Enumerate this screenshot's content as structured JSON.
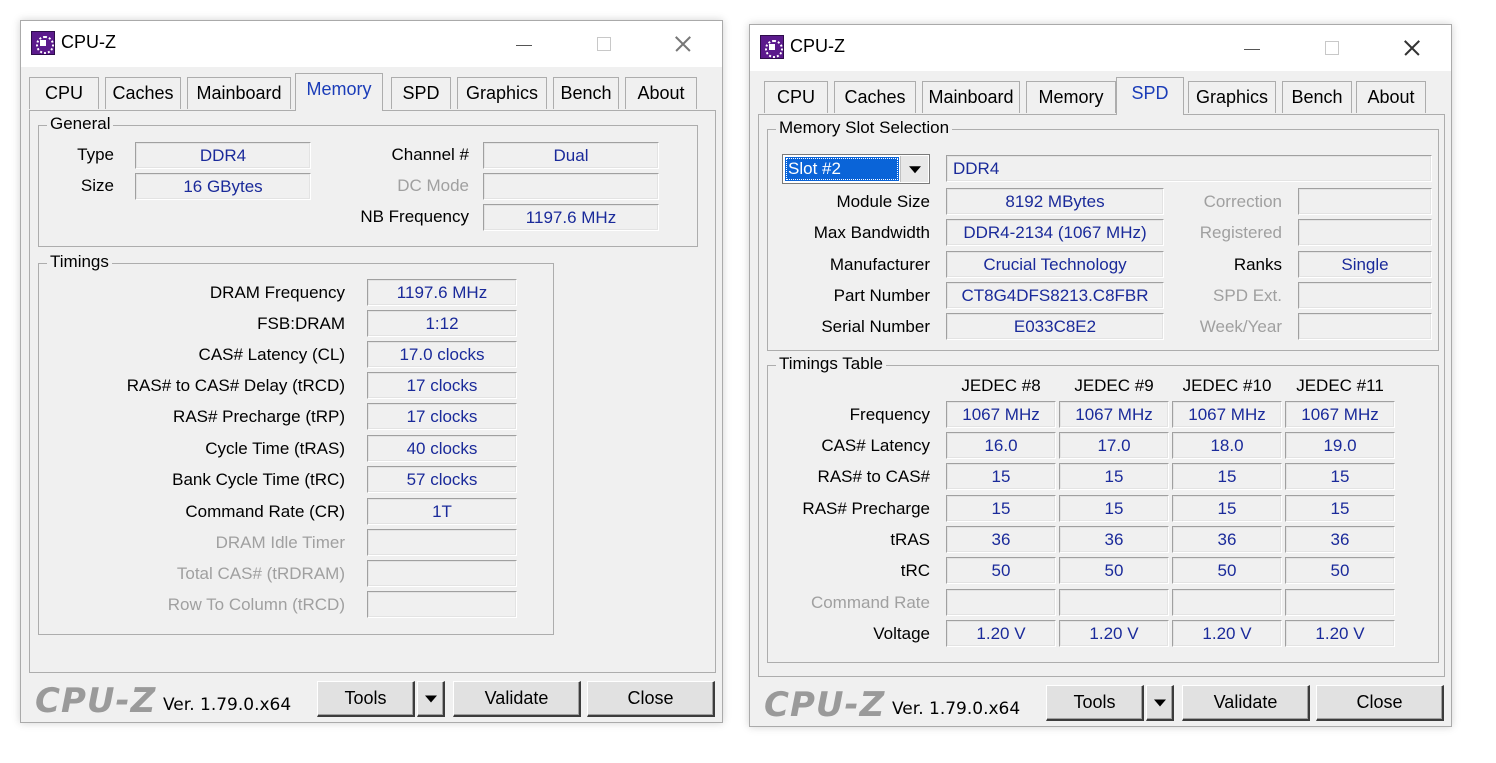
{
  "windows": {
    "left": {
      "title": "CPU-Z",
      "tabs": [
        "CPU",
        "Caches",
        "Mainboard",
        "Memory",
        "SPD",
        "Graphics",
        "Bench",
        "About"
      ],
      "active_tab": "Memory",
      "general": {
        "title": "General",
        "type_label": "Type",
        "type_value": "DDR4",
        "size_label": "Size",
        "size_value": "16 GBytes",
        "channel_label": "Channel #",
        "channel_value": "Dual",
        "dcmode_label": "DC Mode",
        "dcmode_value": "",
        "nbfreq_label": "NB Frequency",
        "nbfreq_value": "1197.6 MHz"
      },
      "timings": {
        "title": "Timings",
        "rows": [
          {
            "label": "DRAM Frequency",
            "value": "1197.6 MHz",
            "disabled": false
          },
          {
            "label": "FSB:DRAM",
            "value": "1:12",
            "disabled": false
          },
          {
            "label": "CAS# Latency (CL)",
            "value": "17.0 clocks",
            "disabled": false
          },
          {
            "label": "RAS# to CAS# Delay (tRCD)",
            "value": "17 clocks",
            "disabled": false
          },
          {
            "label": "RAS# Precharge (tRP)",
            "value": "17 clocks",
            "disabled": false
          },
          {
            "label": "Cycle Time (tRAS)",
            "value": "40 clocks",
            "disabled": false
          },
          {
            "label": "Bank Cycle Time (tRC)",
            "value": "57 clocks",
            "disabled": false
          },
          {
            "label": "Command Rate (CR)",
            "value": "1T",
            "disabled": false
          },
          {
            "label": "DRAM Idle Timer",
            "value": "",
            "disabled": true
          },
          {
            "label": "Total CAS# (tRDRAM)",
            "value": "",
            "disabled": true
          },
          {
            "label": "Row To Column (tRCD)",
            "value": "",
            "disabled": true
          }
        ]
      },
      "footer": {
        "logo": "CPU-Z",
        "version": "Ver. 1.79.0.x64",
        "tools": "Tools",
        "validate": "Validate",
        "close": "Close"
      }
    },
    "right": {
      "title": "CPU-Z",
      "tabs": [
        "CPU",
        "Caches",
        "Mainboard",
        "Memory",
        "SPD",
        "Graphics",
        "Bench",
        "About"
      ],
      "active_tab": "SPD",
      "slot": {
        "title": "Memory Slot Selection",
        "selected": "Slot #2",
        "mem_type": "DDR4",
        "module_size_label": "Module Size",
        "module_size": "8192 MBytes",
        "max_bw_label": "Max Bandwidth",
        "max_bw": "DDR4-2134 (1067 MHz)",
        "manufacturer_label": "Manufacturer",
        "manufacturer": "Crucial Technology",
        "part_label": "Part Number",
        "part": "CT8G4DFS8213.C8FBR",
        "serial_label": "Serial Number",
        "serial": "E033C8E2",
        "correction_label": "Correction",
        "correction": "",
        "registered_label": "Registered",
        "registered": "",
        "ranks_label": "Ranks",
        "ranks": "Single",
        "spdext_label": "SPD Ext.",
        "spdext": "",
        "weekyear_label": "Week/Year",
        "weekyear": ""
      },
      "timings_table": {
        "title": "Timings Table",
        "columns": [
          "JEDEC #8",
          "JEDEC #9",
          "JEDEC #10",
          "JEDEC #11"
        ],
        "rows": [
          {
            "label": "Frequency",
            "values": [
              "1067 MHz",
              "1067 MHz",
              "1067 MHz",
              "1067 MHz"
            ],
            "disabled": false
          },
          {
            "label": "CAS# Latency",
            "values": [
              "16.0",
              "17.0",
              "18.0",
              "19.0"
            ],
            "disabled": false
          },
          {
            "label": "RAS# to CAS#",
            "values": [
              "15",
              "15",
              "15",
              "15"
            ],
            "disabled": false
          },
          {
            "label": "RAS# Precharge",
            "values": [
              "15",
              "15",
              "15",
              "15"
            ],
            "disabled": false
          },
          {
            "label": "tRAS",
            "values": [
              "36",
              "36",
              "36",
              "36"
            ],
            "disabled": false
          },
          {
            "label": "tRC",
            "values": [
              "50",
              "50",
              "50",
              "50"
            ],
            "disabled": false
          },
          {
            "label": "Command Rate",
            "values": [
              "",
              "",
              "",
              ""
            ],
            "disabled": true
          },
          {
            "label": "Voltage",
            "values": [
              "1.20 V",
              "1.20 V",
              "1.20 V",
              "1.20 V"
            ],
            "disabled": false
          }
        ]
      },
      "footer": {
        "logo": "CPU-Z",
        "version": "Ver. 1.79.0.x64",
        "tools": "Tools",
        "validate": "Validate",
        "close": "Close"
      }
    }
  }
}
